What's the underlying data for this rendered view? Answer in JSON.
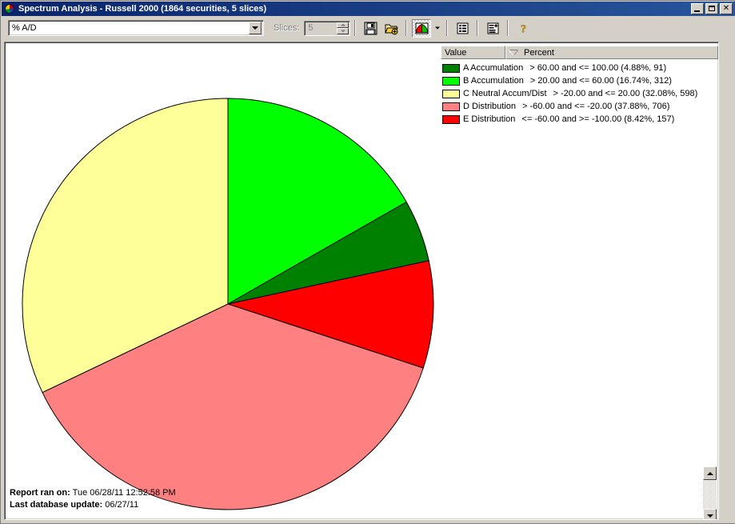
{
  "window": {
    "title": "Spectrum Analysis - Russell 2000 (1864 securities, 5 slices)",
    "icon": "pie-chart-icon",
    "minimize_label": "_",
    "maximize_label": "",
    "close_label": "✕"
  },
  "toolbar": {
    "field_selector_value": "% A/D",
    "slices_label": "Slices:",
    "slices_value": "5",
    "buttons": [
      {
        "name": "save-button",
        "icon": "floppy-disk-icon"
      },
      {
        "name": "open-add-button",
        "icon": "folder-add-icon"
      },
      {
        "name": "chart-type-button",
        "icon": "pie-chart-icon"
      },
      {
        "name": "chart-type-dropdown",
        "icon": "chevron-down-icon"
      },
      {
        "name": "list-view-button",
        "icon": "list-icon"
      },
      {
        "name": "report-button",
        "icon": "report-add-icon"
      },
      {
        "name": "help-button",
        "icon": "question-mark-icon"
      }
    ]
  },
  "legend": {
    "columns": [
      "Value",
      "Percent"
    ],
    "sort_indicator": "descending",
    "rows": [
      {
        "color": "#008000",
        "name": "A Accumulation",
        "range": "> 60.00 and <= 100.00 (4.88%, 91)"
      },
      {
        "color": "#00FF00",
        "name": "B Accumulation",
        "range": "> 20.00 and <= 60.00 (16.74%, 312)"
      },
      {
        "color": "#FFFF99",
        "name": "C Neutral Accum/Dist",
        "range": "> -20.00 and <= 20.00 (32.08%, 598)"
      },
      {
        "color": "#FF8080",
        "name": "D Distribution",
        "range": "> -60.00 and <= -20.00 (37.88%, 706)"
      },
      {
        "color": "#FF0000",
        "name": "E Distribution",
        "range": "<= -60.00 and >= -100.00 (8.42%, 157)"
      }
    ]
  },
  "footer": {
    "report_label": "Report ran on:",
    "report_value": "Tue 06/28/11 12:52:58 PM",
    "update_label": "Last database update:",
    "update_value": "06/27/11"
  },
  "chart_data": {
    "type": "pie",
    "title": "Spectrum Analysis - Russell 2000",
    "start_angle": 0,
    "direction": "clockwise",
    "center": [
      279,
      327
    ],
    "radius": 257,
    "total_securities": 1864,
    "slice_count": 5,
    "categories": [
      "B Accumulation",
      "A Accumulation",
      "E Distribution",
      "D Distribution",
      "C Neutral Accum/Dist"
    ],
    "values": [
      16.74,
      4.88,
      8.42,
      37.88,
      32.08
    ],
    "counts": [
      312,
      91,
      157,
      706,
      598
    ],
    "colors": [
      "#00FF00",
      "#008000",
      "#FF0000",
      "#FF8080",
      "#FFFF99"
    ],
    "slices": [
      {
        "label": "B Accumulation",
        "percent": 16.74,
        "count": 312,
        "color": "#00FF00"
      },
      {
        "label": "A Accumulation",
        "percent": 4.88,
        "count": 91,
        "color": "#008000"
      },
      {
        "label": "E Distribution",
        "percent": 8.42,
        "count": 157,
        "color": "#FF0000"
      },
      {
        "label": "D Distribution",
        "percent": 37.88,
        "count": 706,
        "color": "#FF8080"
      },
      {
        "label": "C Neutral Accum/Dist",
        "percent": 32.08,
        "count": 598,
        "color": "#FFFF99"
      }
    ],
    "legend_position": "top-right",
    "grid": false
  }
}
